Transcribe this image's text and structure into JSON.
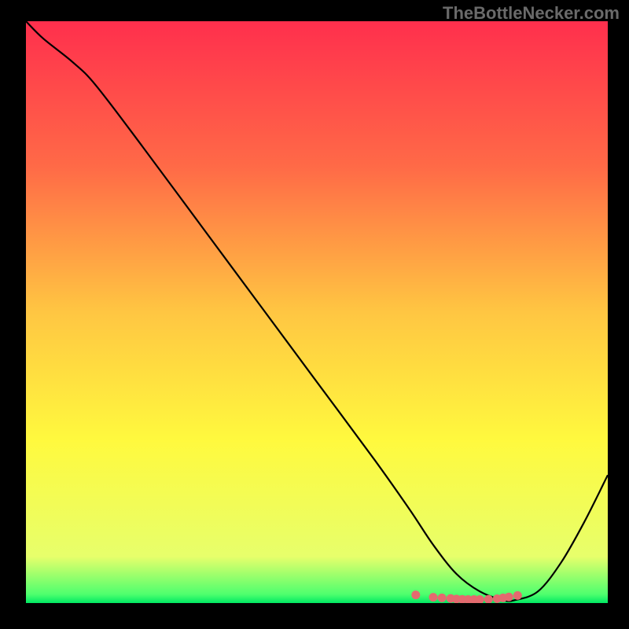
{
  "watermark": "TheBottleNecker.com",
  "chart_data": {
    "type": "line",
    "title": "",
    "xlabel": "",
    "ylabel": "",
    "xlim": [
      0,
      100
    ],
    "ylim": [
      0,
      100
    ],
    "style": {
      "background": "vertical-gradient-red-to-green",
      "gradient_stops": [
        {
          "pos": 0.0,
          "color": "#ff2f4d"
        },
        {
          "pos": 0.25,
          "color": "#ff6a47"
        },
        {
          "pos": 0.5,
          "color": "#ffc642"
        },
        {
          "pos": 0.72,
          "color": "#fff93e"
        },
        {
          "pos": 0.92,
          "color": "#e7ff6b"
        },
        {
          "pos": 0.985,
          "color": "#4eff6e"
        },
        {
          "pos": 1.0,
          "color": "#00e863"
        }
      ],
      "line_color": "#000000",
      "marker_color": "#e46a6f"
    },
    "series": [
      {
        "name": "curve",
        "x": [
          0,
          3,
          8,
          12,
          20,
          30,
          40,
          50,
          60,
          66,
          70,
          74,
          78,
          82,
          84,
          88,
          92,
          96,
          100
        ],
        "y": [
          100,
          97,
          93,
          89,
          78.5,
          65,
          51.5,
          38,
          24.5,
          16,
          10,
          5,
          2,
          0.5,
          0.5,
          2,
          7,
          14,
          22
        ]
      }
    ],
    "markers": {
      "name": "flat-bottom-dots",
      "x": [
        67,
        70,
        71.5,
        73,
        74,
        75,
        76,
        77,
        78,
        79.5,
        81,
        82,
        83,
        84.5
      ],
      "y": [
        1.4,
        1.0,
        0.9,
        0.8,
        0.7,
        0.65,
        0.6,
        0.6,
        0.6,
        0.65,
        0.75,
        0.9,
        1.05,
        1.3
      ]
    }
  }
}
